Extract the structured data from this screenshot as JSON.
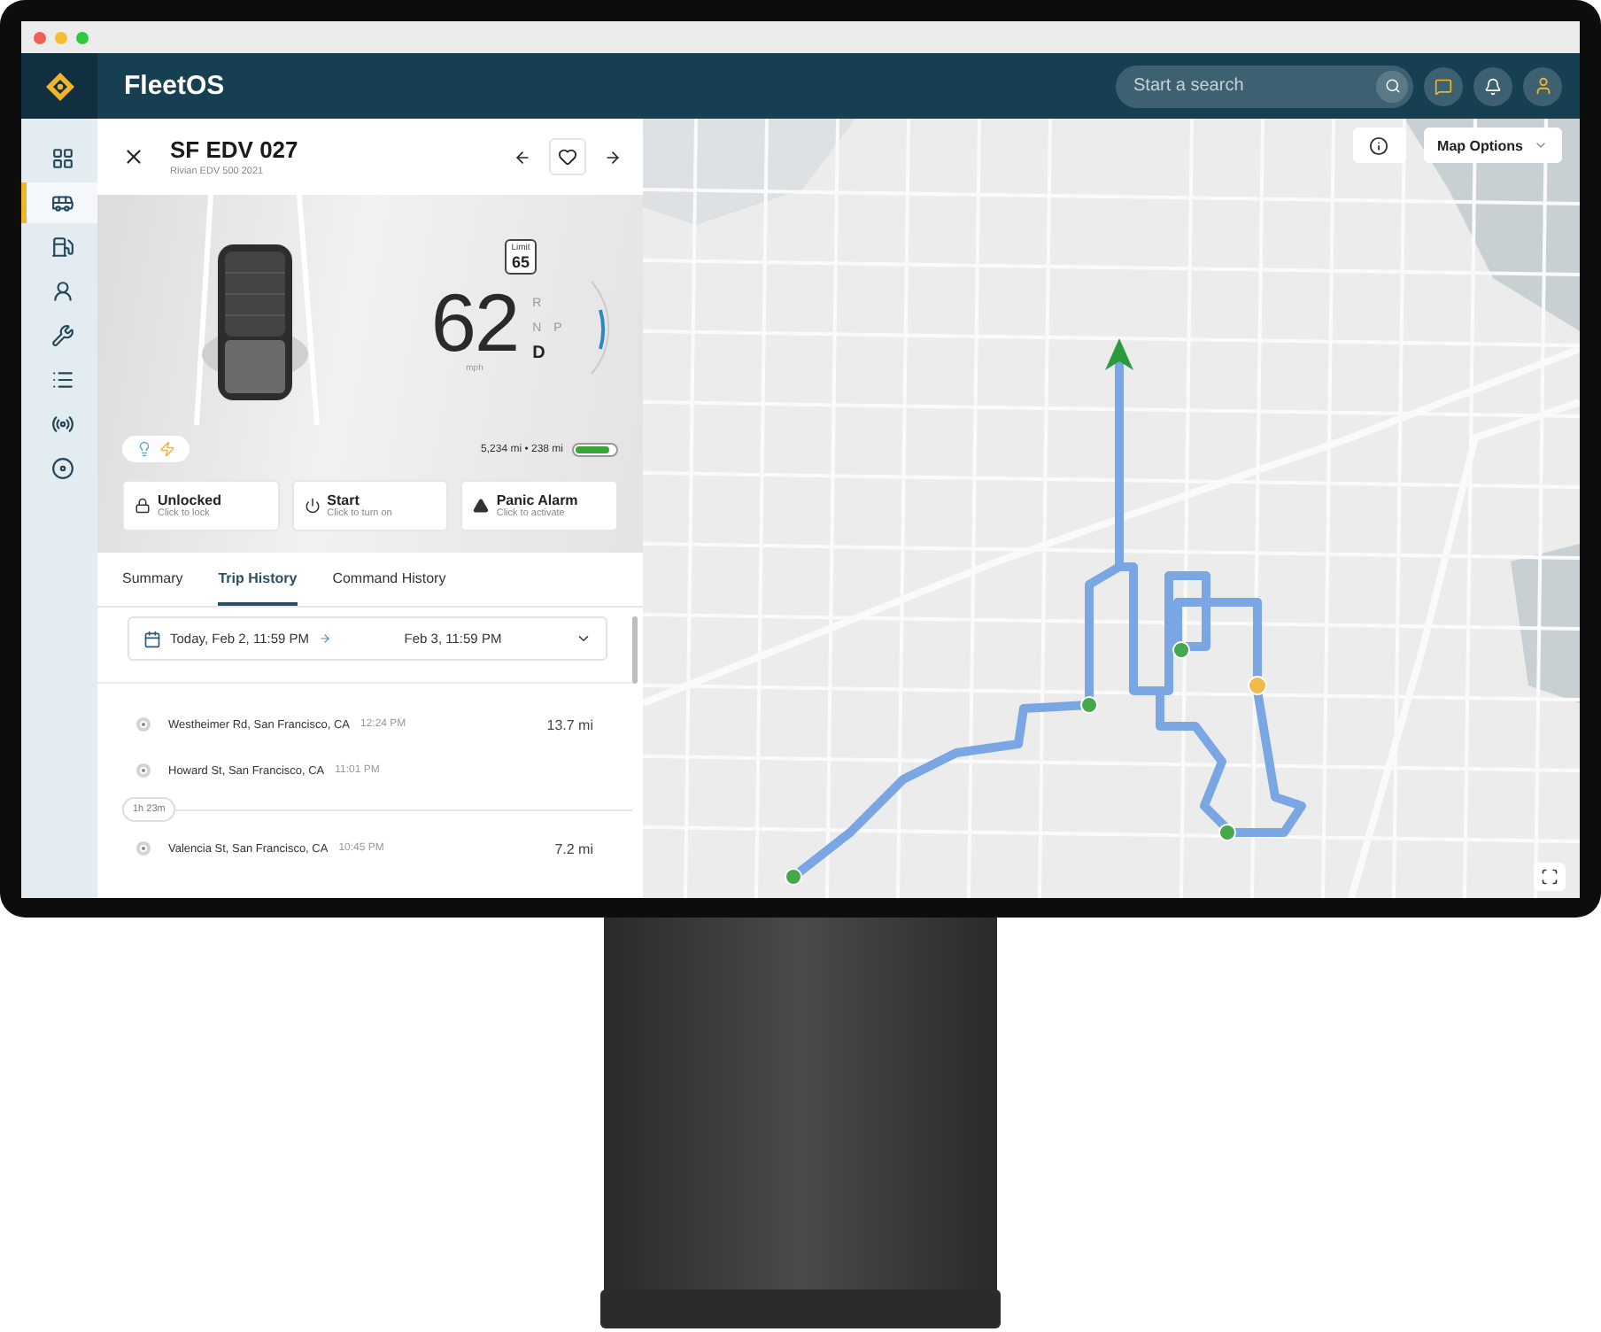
{
  "app": {
    "name": "FleetOS",
    "search": {
      "placeholder": "Start a search"
    }
  },
  "sidebar": {
    "items": [
      {
        "selected": false
      },
      {
        "selected": true
      },
      {
        "selected": false
      },
      {
        "selected": false
      },
      {
        "selected": false
      },
      {
        "selected": false
      },
      {
        "selected": false
      },
      {
        "selected": false
      }
    ]
  },
  "vehicle": {
    "name": "SF EDV 027",
    "model": "Rivian EDV 500 2021",
    "favorite": false,
    "speed_limit": {
      "label": "Limit",
      "value": "65"
    },
    "speed": "62",
    "unit": "mph",
    "gears": [
      {
        "label": "R",
        "selected": false
      },
      {
        "label": "N",
        "selected": false
      },
      {
        "label": "P",
        "selected": false
      },
      {
        "label": "D",
        "selected": true
      }
    ],
    "odometer": "5,234 mi • 238 mi",
    "battery": {
      "level": 0.85
    }
  },
  "actions": [
    {
      "kind": "lock",
      "label": "Unlocked",
      "hint": "Click to lock"
    },
    {
      "kind": "power",
      "label": "Start",
      "hint": "Click to turn on"
    },
    {
      "kind": "alarm",
      "label": "Panic Alarm",
      "hint": "Click to activate"
    }
  ],
  "tabs": [
    {
      "label": "Summary",
      "selected": false
    },
    {
      "label": "Trip History",
      "selected": true
    },
    {
      "label": "Command History",
      "selected": false
    }
  ],
  "date_range": {
    "from": "Today, Feb 2, 11:59 PM",
    "to": "Feb 3, 11:59 PM"
  },
  "trips": [
    {
      "stops": [
        {
          "place": "Westheimer Rd, San Francisco, CA",
          "time": "12:24 PM"
        },
        {
          "place": "Howard St, San Francisco, CA",
          "time": "11:01 PM"
        }
      ],
      "distance": "13.7 mi",
      "gap": "1h 23m"
    },
    {
      "stops": [
        {
          "place": "Valencia St, San Francisco, CA",
          "time": "10:45 PM"
        }
      ],
      "distance": "7.2 mi"
    }
  ],
  "map": {
    "options_label": "Map Options"
  }
}
